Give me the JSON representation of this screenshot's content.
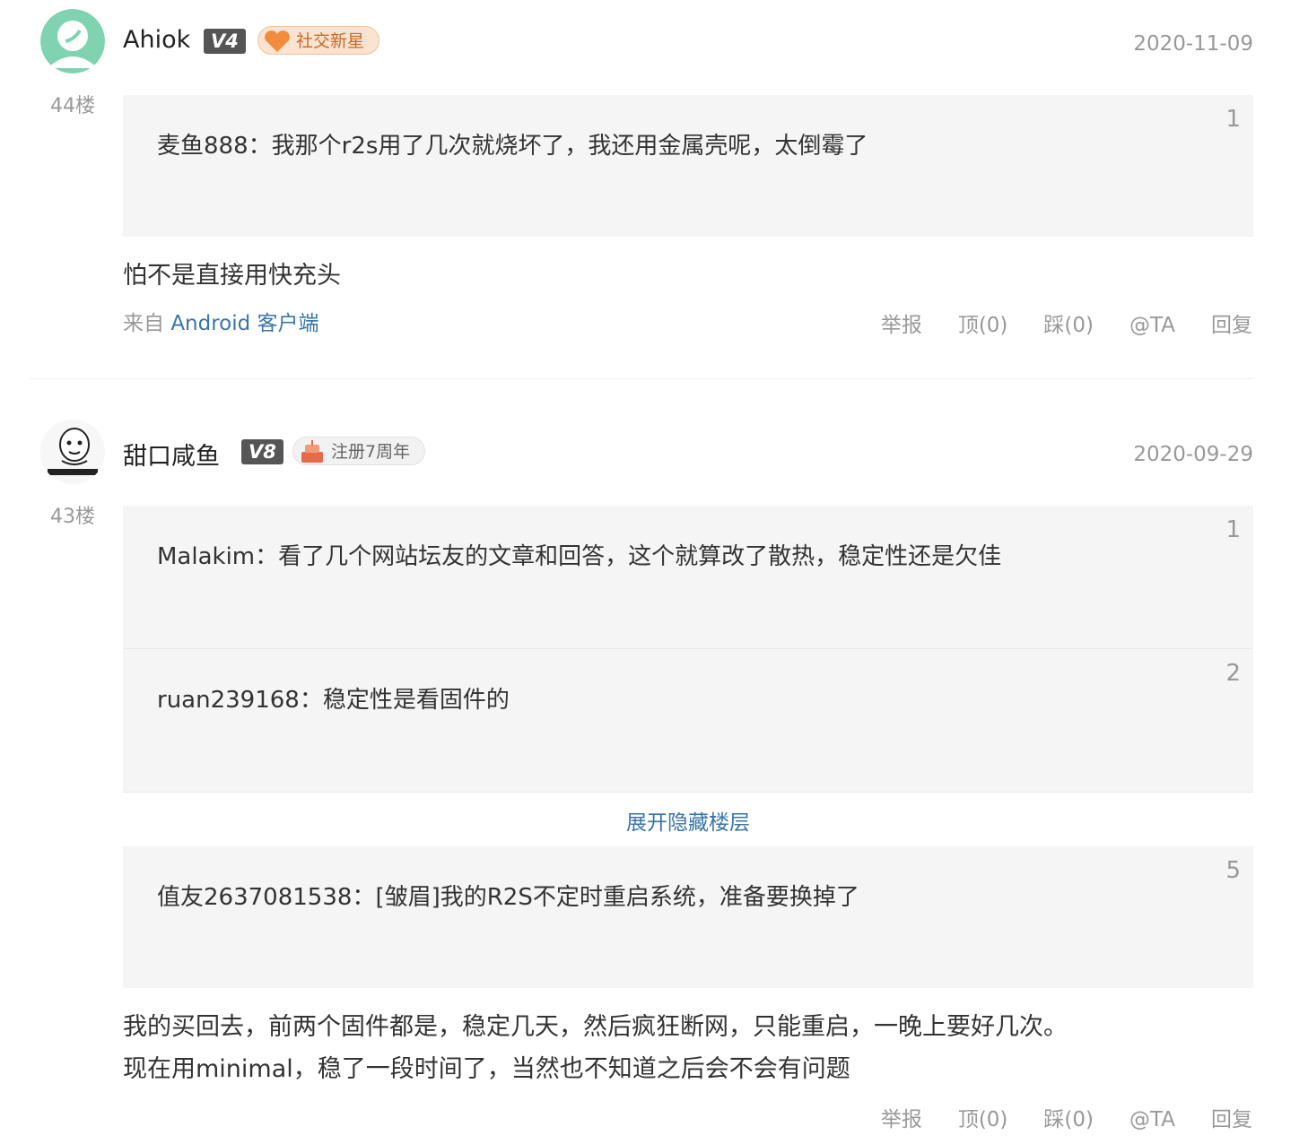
{
  "comments": [
    {
      "username": "Ahiok",
      "level": "V4",
      "badge": "社交新星",
      "date": "2020-11-09",
      "floor": "44楼",
      "quotes": [
        {
          "author": "麦鱼888",
          "sep": "：",
          "text": "我那个r2s用了几次就烧坏了，我还用金属壳呢，太倒霉了",
          "num": "1"
        }
      ],
      "text_lines": [
        "怕不是直接用快充头"
      ],
      "source_prefix": "来自",
      "source_link": "Android 客户端",
      "actions": {
        "report": "举报",
        "up": "顶(0)",
        "down": "踩(0)",
        "at": "@TA",
        "reply": "回复"
      }
    },
    {
      "username": "甜口咸鱼",
      "level": "V8",
      "badge": "注册7周年",
      "date": "2020-09-29",
      "floor": "43楼",
      "quotes": [
        {
          "author": "Malakim",
          "sep": "：",
          "text": "看了几个网站坛友的文章和回答，这个就算改了散热，稳定性还是欠佳",
          "num": "1"
        },
        {
          "author": "ruan239168",
          "sep": "：",
          "text": "稳定性是看固件的",
          "num": "2"
        },
        {
          "author": "值友2637081538",
          "sep": "：",
          "text": "[皱眉]我的R2S不定时重启系统，准备要换掉了",
          "num": "5"
        }
      ],
      "expand_label": "展开隐藏楼层",
      "text_lines": [
        "我的买回去，前两个固件都是，稳定几天，然后疯狂断网，只能重启，一晚上要好几次。",
        "现在用minimal，稳了一段时间了，当然也不知道之后会不会有问题"
      ],
      "actions": {
        "report": "举报",
        "up": "顶(0)",
        "down": "踩(0)",
        "at": "@TA",
        "reply": "回复"
      }
    }
  ],
  "colors": {
    "link": "#3a74a8",
    "muted": "#999999",
    "quote_bg": "#f5f5f5",
    "level_bg": "#555555"
  }
}
